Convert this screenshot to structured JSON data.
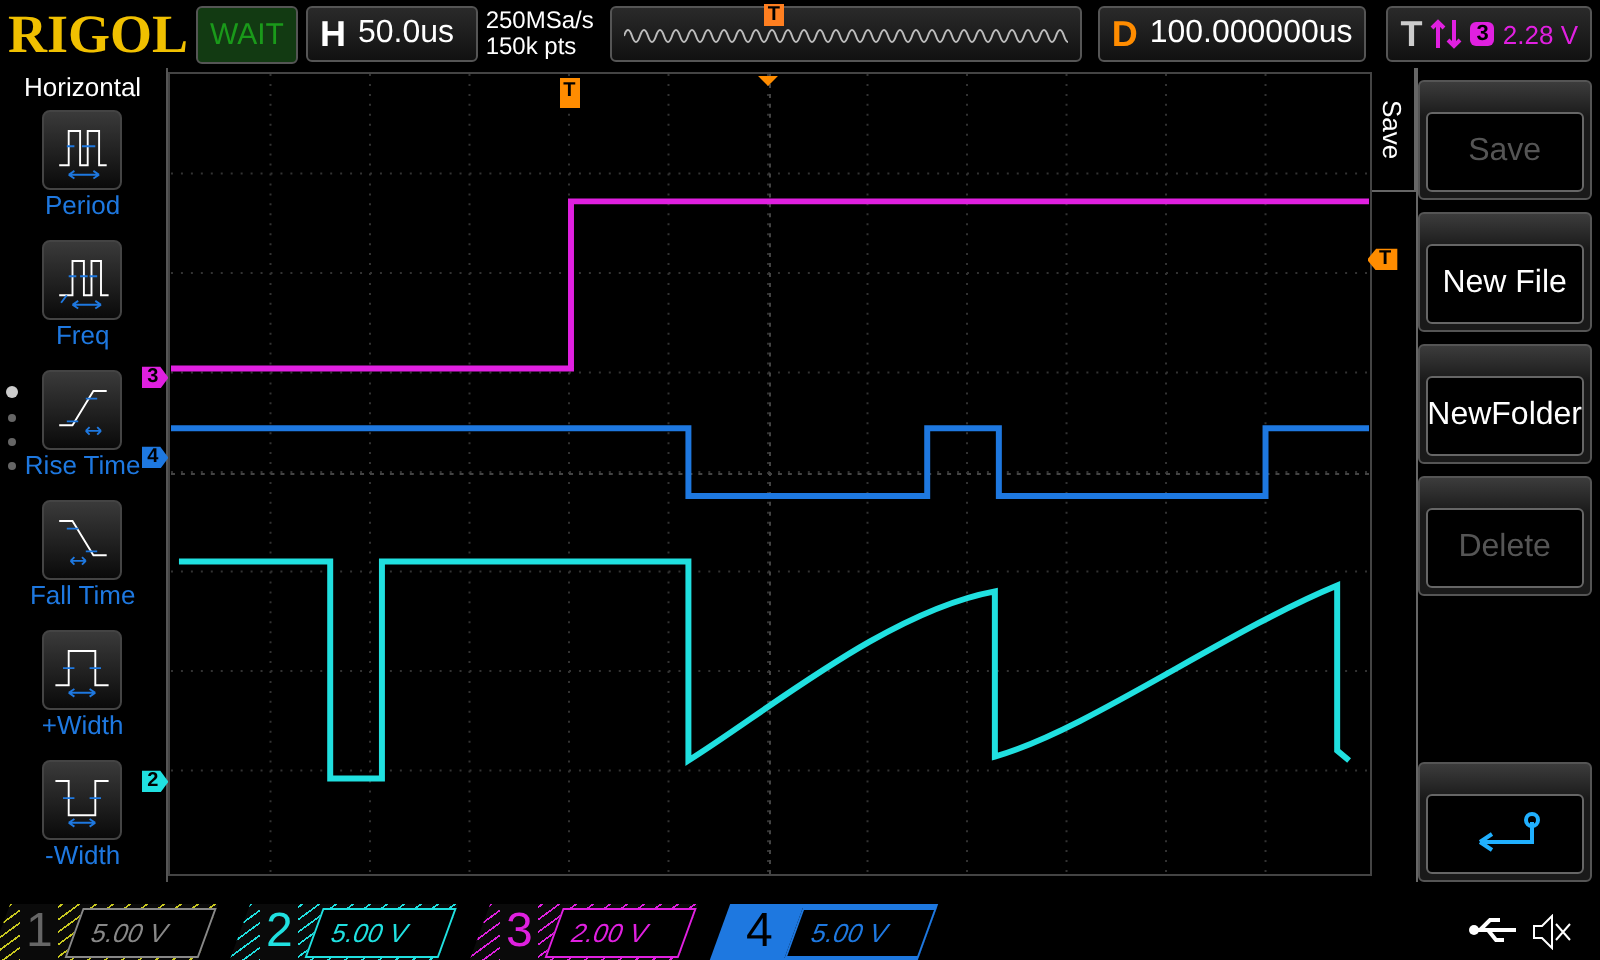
{
  "header": {
    "brand": "RIGOL",
    "status": "WAIT",
    "timebase_label": "H",
    "timebase": "50.0us",
    "sample_rate": "250MSa/s",
    "memory_depth": "150k pts",
    "position_marker": "T",
    "delay_label": "D",
    "delay": "100.000000us",
    "trigger_label": "T",
    "trigger_source": "3",
    "trigger_level": "2.28 V"
  },
  "measure_menu": {
    "title": "Horizontal",
    "items": [
      {
        "label": "Period",
        "kind": "period"
      },
      {
        "label": "Freq",
        "kind": "freq"
      },
      {
        "label": "Rise Time",
        "kind": "rise"
      },
      {
        "label": "Fall Time",
        "kind": "fall"
      },
      {
        "label": "+Width",
        "kind": "pwidth"
      },
      {
        "label": "-Width",
        "kind": "nwidth"
      }
    ]
  },
  "waveform": {
    "trigger_marker": "T",
    "level_marker": "T",
    "markers": [
      {
        "label": "3",
        "color": "#e020e0",
        "kind": "ch3"
      },
      {
        "label": "4",
        "color": "#1e78e0",
        "kind": "ch4"
      },
      {
        "label": "2",
        "color": "#20e0e0",
        "kind": "ch2"
      }
    ]
  },
  "softkey_menu": {
    "title": "Save",
    "items": [
      {
        "kind": "button",
        "label": "Save",
        "disabled": true
      },
      {
        "kind": "button",
        "label": "New File",
        "disabled": false
      },
      {
        "kind": "button",
        "label": "NewFolder",
        "disabled": false
      },
      {
        "kind": "button",
        "label": "Delete",
        "disabled": true
      },
      {
        "kind": "back"
      }
    ]
  },
  "channels": [
    {
      "number": "1",
      "scale": "5.00 V",
      "on": false,
      "selected": false,
      "color": "#c8c820"
    },
    {
      "number": "2",
      "scale": "5.00 V",
      "on": true,
      "selected": false,
      "color": "#20e0e0"
    },
    {
      "number": "3",
      "scale": "2.00 V",
      "on": true,
      "selected": false,
      "color": "#e020e0"
    },
    {
      "number": "4",
      "scale": "5.00 V",
      "on": true,
      "selected": true,
      "color": "#1e78e0"
    }
  ]
}
